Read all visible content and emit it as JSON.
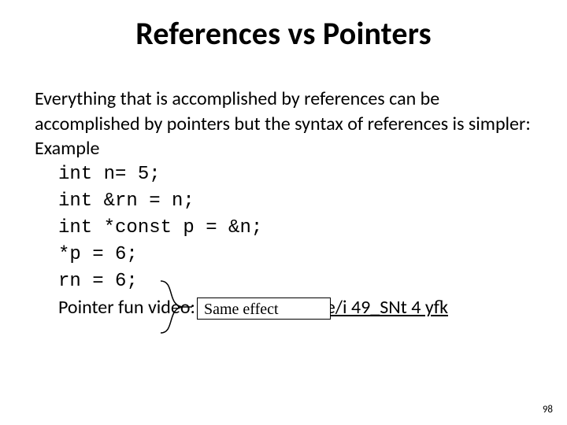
{
  "title": "References vs Pointers",
  "intro": "Everything that is accomplished by references can be accomplished by pointers but the syntax of references is simpler:",
  "example_label": "Example",
  "code": {
    "l1": "int n= 5;",
    "l2": "int &rn = n;",
    "l3": "int *const p = &n;",
    "l4": "*p = 6;",
    "l5": "rn = 6;"
  },
  "callout": "Same effect",
  "video_label": "Pointer fun video: ",
  "video_url_text": "https: //youtu. be/i 49_SNt 4 yfk",
  "page_number": "98"
}
